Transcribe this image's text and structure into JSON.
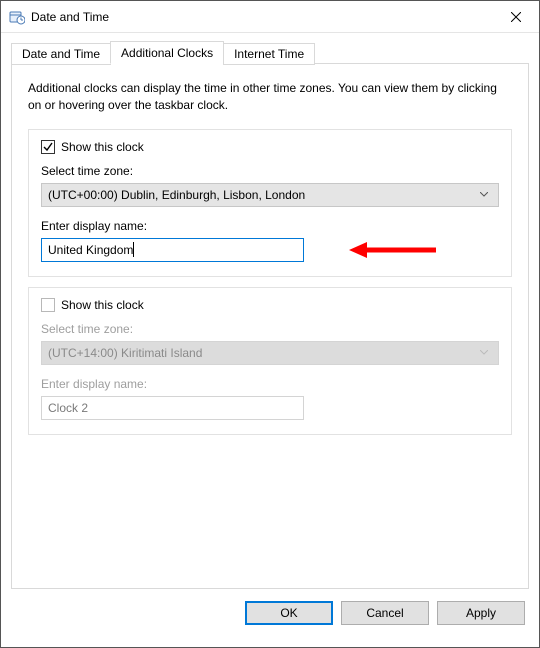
{
  "window": {
    "title": "Date and Time"
  },
  "tabs": {
    "date_time": "Date and Time",
    "additional_clocks": "Additional Clocks",
    "internet_time": "Internet Time"
  },
  "description": "Additional clocks can display the time in other time zones. You can view them by clicking on or hovering over the taskbar clock.",
  "clock1": {
    "show_label": "Show this clock",
    "tz_label": "Select time zone:",
    "tz_value": "(UTC+00:00) Dublin, Edinburgh, Lisbon, London",
    "name_label": "Enter display name:",
    "name_value": "United Kingdom"
  },
  "clock2": {
    "show_label": "Show this clock",
    "tz_label": "Select time zone:",
    "tz_value": "(UTC+14:00) Kiritimati Island",
    "name_label": "Enter display name:",
    "name_value": "Clock 2"
  },
  "buttons": {
    "ok": "OK",
    "cancel": "Cancel",
    "apply": "Apply"
  }
}
